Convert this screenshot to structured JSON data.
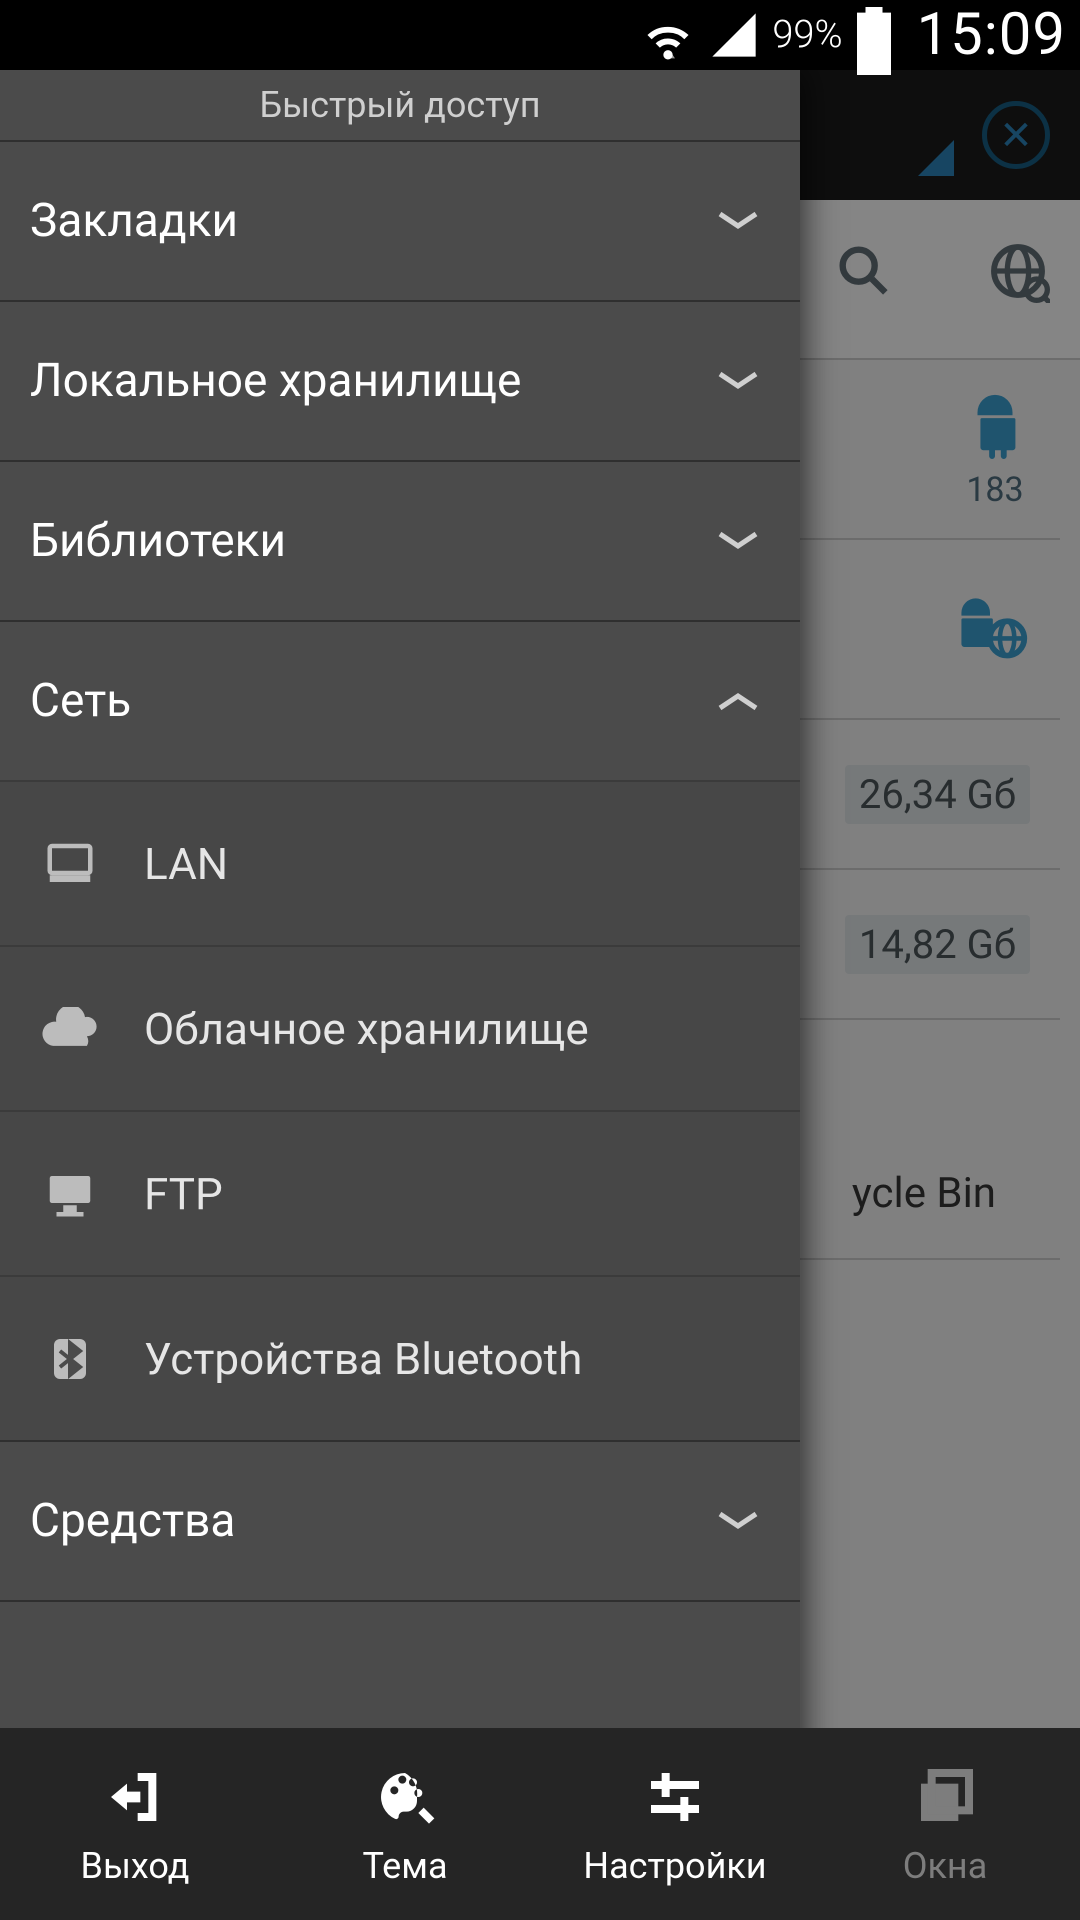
{
  "status": {
    "battery_pct": "99%",
    "clock": "15:09"
  },
  "drawer": {
    "title": "Быстрый доступ",
    "cats": {
      "bookmarks": "Закладки",
      "local": "Локальное хранилище",
      "libs": "Библиотеки",
      "net": "Сеть",
      "tools": "Средства"
    },
    "net_items": {
      "lan": "LAN",
      "cloud": "Облачное хранилище",
      "ftp": "FTP",
      "bt": "Устройства Bluetooth"
    }
  },
  "back": {
    "android_count": "183",
    "gb1": "26,34 Gб",
    "gb2": "14,82 Gб",
    "bin": "ycle Bin"
  },
  "bottom": {
    "exit": "Выход",
    "theme": "Тема",
    "settings": "Настройки",
    "windows": "Окна"
  }
}
